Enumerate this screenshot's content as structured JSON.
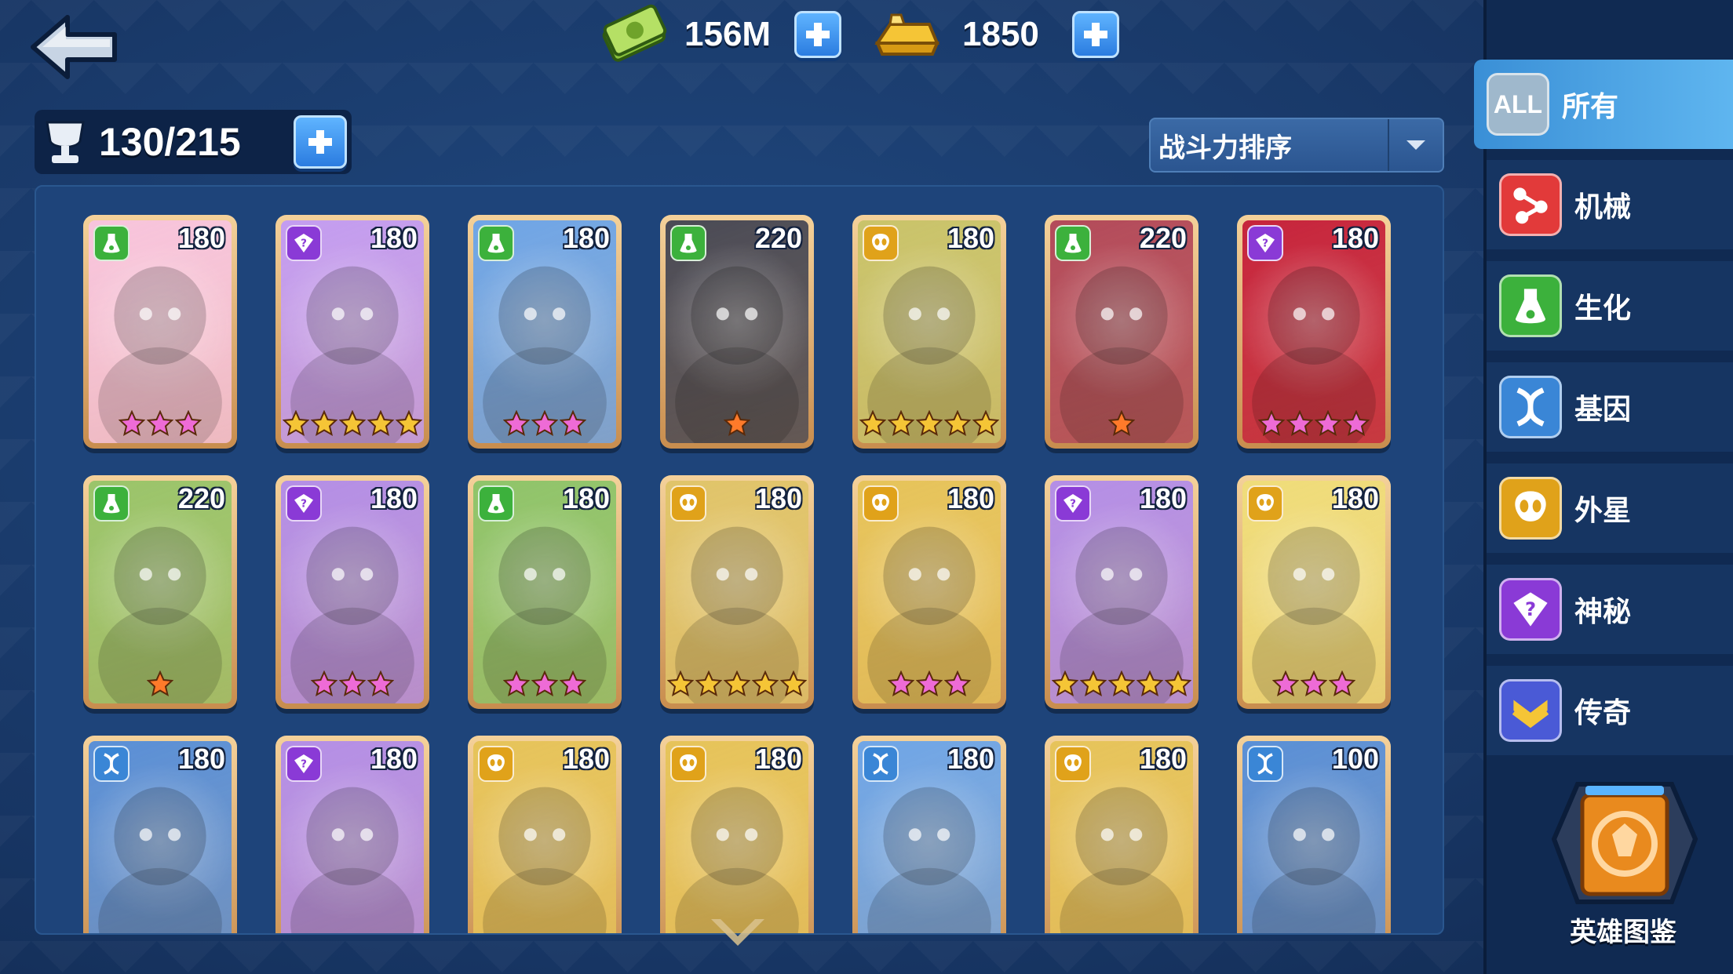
{
  "top": {
    "cash": {
      "icon": "cash-icon",
      "value": "156M"
    },
    "gold": {
      "icon": "gold-bar-icon",
      "value": "1850"
    }
  },
  "capacity": {
    "icon": "trophy-cup-icon",
    "value": "130/215"
  },
  "sort": {
    "label": "战斗力排序"
  },
  "factions": [
    {
      "key": "all",
      "icon_text": "ALL",
      "label": "所有",
      "color": "#9fb8cc",
      "active": true
    },
    {
      "key": "mech",
      "label": "机械",
      "color": "#e23a3a"
    },
    {
      "key": "bio",
      "label": "生化",
      "color": "#3cb13c"
    },
    {
      "key": "gene",
      "label": "基因",
      "color": "#3a86d6"
    },
    {
      "key": "alien",
      "label": "外星",
      "color": "#e0a21a"
    },
    {
      "key": "mystic",
      "label": "神秘",
      "color": "#8a3ad6"
    },
    {
      "key": "legend",
      "label": "传奇",
      "color": "#4a5ad6"
    }
  ],
  "codex": {
    "label": "英雄图鉴"
  },
  "heroes": [
    {
      "faction": "bio",
      "level": "180",
      "stars": 3,
      "star_color": "pink",
      "bg": "#f7c4dc"
    },
    {
      "faction": "mystic",
      "level": "180",
      "stars": 5,
      "star_color": "gold",
      "bg": "#c39cf0"
    },
    {
      "faction": "bio",
      "level": "180",
      "stars": 3,
      "star_color": "pink",
      "bg": "#6fa5e6"
    },
    {
      "faction": "bio",
      "level": "220",
      "stars": 1,
      "star_color": "orange",
      "bg": "#4a4a55"
    },
    {
      "faction": "alien",
      "level": "180",
      "stars": 5,
      "star_color": "gold",
      "bg": "#c9c36a"
    },
    {
      "faction": "bio",
      "level": "220",
      "stars": 1,
      "star_color": "orange",
      "bg": "#b34a5a"
    },
    {
      "faction": "mystic",
      "level": "180",
      "stars": 4,
      "star_color": "pink",
      "bg": "#c6243c"
    },
    {
      "faction": "bio",
      "level": "220",
      "stars": 1,
      "star_color": "orange",
      "bg": "#9ac46a"
    },
    {
      "faction": "mystic",
      "level": "180",
      "stars": 3,
      "star_color": "pink",
      "bg": "#b48ee6"
    },
    {
      "faction": "bio",
      "level": "180",
      "stars": 3,
      "star_color": "pink",
      "bg": "#8fc46a"
    },
    {
      "faction": "alien",
      "level": "180",
      "stars": 5,
      "star_color": "gold",
      "bg": "#e0c46a"
    },
    {
      "faction": "alien",
      "level": "180",
      "stars": 3,
      "star_color": "pink",
      "bg": "#e6c35a"
    },
    {
      "faction": "mystic",
      "level": "180",
      "stars": 5,
      "star_color": "gold",
      "bg": "#b48ee6"
    },
    {
      "faction": "alien",
      "level": "180",
      "stars": 3,
      "star_color": "pink",
      "bg": "#efdc7a"
    },
    {
      "faction": "gene",
      "level": "180",
      "stars": 0,
      "star_color": "pink",
      "bg": "#5a8fd6"
    },
    {
      "faction": "mystic",
      "level": "180",
      "stars": 0,
      "star_color": "pink",
      "bg": "#b48ee6"
    },
    {
      "faction": "alien",
      "level": "180",
      "stars": 0,
      "star_color": "pink",
      "bg": "#e6c35a"
    },
    {
      "faction": "alien",
      "level": "180",
      "stars": 0,
      "star_color": "pink",
      "bg": "#e6c35a"
    },
    {
      "faction": "gene",
      "level": "180",
      "stars": 0,
      "star_color": "pink",
      "bg": "#6fa5e6"
    },
    {
      "faction": "alien",
      "level": "180",
      "stars": 0,
      "star_color": "pink",
      "bg": "#e6c35a"
    },
    {
      "faction": "gene",
      "level": "100",
      "stars": 0,
      "star_color": "pink",
      "bg": "#5a8fd6"
    }
  ]
}
